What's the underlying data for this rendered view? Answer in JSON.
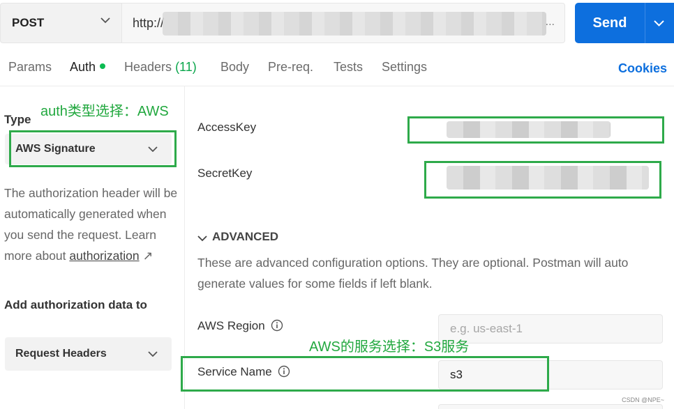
{
  "request": {
    "method": "POST",
    "url_visible": "http://",
    "url_ellipsis": "...",
    "send_label": "Send"
  },
  "tabs": [
    {
      "label": "Params"
    },
    {
      "label": "Auth"
    },
    {
      "label": "Headers",
      "count": "(11)"
    },
    {
      "label": "Body"
    },
    {
      "label": "Pre-req."
    },
    {
      "label": "Tests"
    },
    {
      "label": "Settings"
    }
  ],
  "cookies_label": "Cookies",
  "left": {
    "type_label": "Type",
    "type_value": "AWS Signature",
    "desc_text": "The authorization header will be automatically generated when you send the request. Learn more about ",
    "desc_link": "authorization",
    "desc_arrow": "↗",
    "add_auth_label": "Add authorization data to",
    "add_auth_value": "Request Headers"
  },
  "right": {
    "access_key_label": "AccessKey",
    "secret_key_label": "SecretKey",
    "advanced_label": "ADVANCED",
    "advanced_desc": "These are advanced configuration options. They are optional. Postman will auto generate values for some fields if left blank.",
    "region_label": "AWS Region",
    "region_placeholder": "e.g. us-east-1",
    "service_label": "Service Name",
    "service_value": "s3"
  },
  "annotations": {
    "auth_type": "auth类型选择：AWS",
    "service": "AWS的服务选择：S3服务"
  },
  "watermark": "CSDN @NPE~",
  "colors": {
    "accent": "#0d6fde",
    "status_dot": "#0cbb52",
    "annotation": "#2eaa4a"
  }
}
